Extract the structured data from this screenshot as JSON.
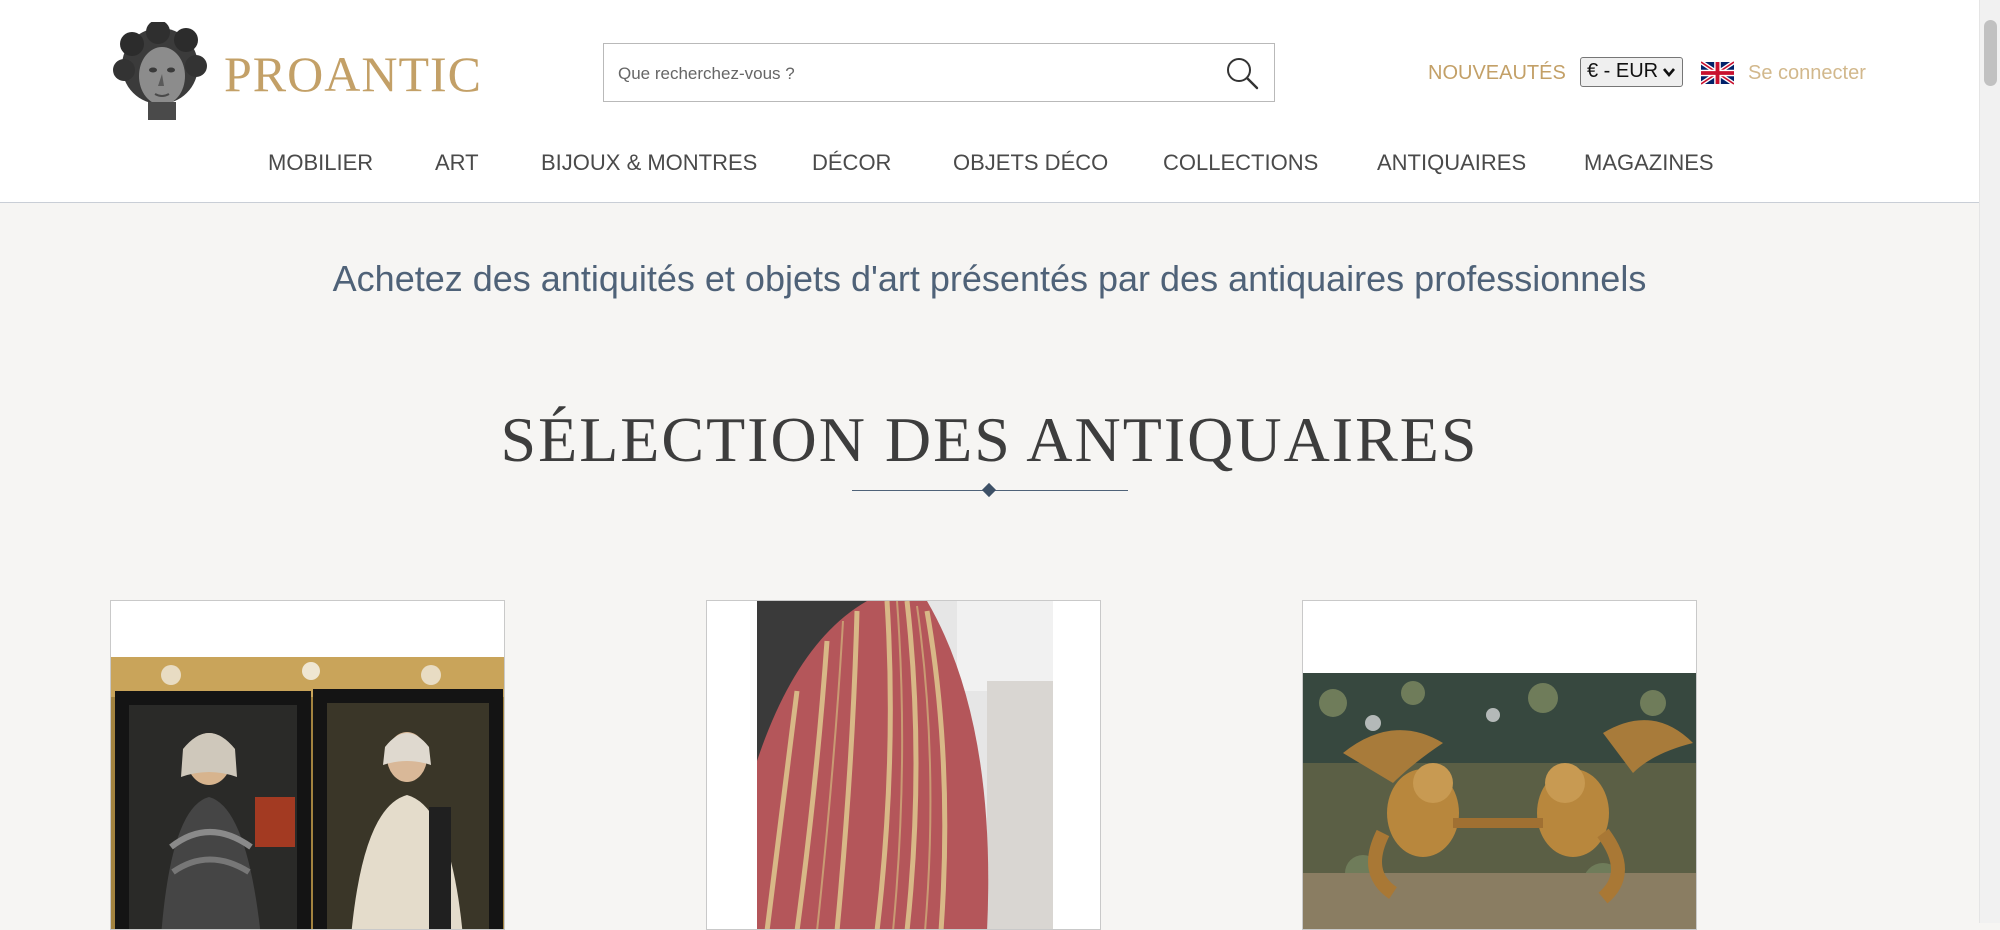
{
  "brand": {
    "name": "PROANTIC",
    "logo": "statue-head-logo"
  },
  "search": {
    "placeholder": "Que recherchez-vous ?",
    "icon": "search-icon"
  },
  "header": {
    "new_label": "NOUVEAUTÉS",
    "currency_selected": "€ - EUR",
    "language_flag": "uk-flag-icon",
    "login_label": "Se connecter"
  },
  "nav": {
    "items": [
      {
        "label": "MOBILIER"
      },
      {
        "label": "ART"
      },
      {
        "label": "BIJOUX & MONTRES"
      },
      {
        "label": "DÉCOR"
      },
      {
        "label": "OBJETS DÉCO"
      },
      {
        "label": "COLLECTIONS"
      },
      {
        "label": "ANTIQUAIRES"
      },
      {
        "label": "MAGAZINES"
      }
    ]
  },
  "main": {
    "tagline": "Achetez des antiquités et objets d'art présentés par des antiquaires professionnels",
    "section_title": "SÉLECTION DES ANTIQUAIRES",
    "cards": [
      {
        "image": "pair-of-portraits"
      },
      {
        "image": "striped-silk-fabric"
      },
      {
        "image": "gilded-cherubs-on-tapestry"
      }
    ]
  },
  "colors": {
    "brand_gold": "#c3a067",
    "tagline_blue": "#4f6278",
    "page_background": "#f6f5f3"
  }
}
